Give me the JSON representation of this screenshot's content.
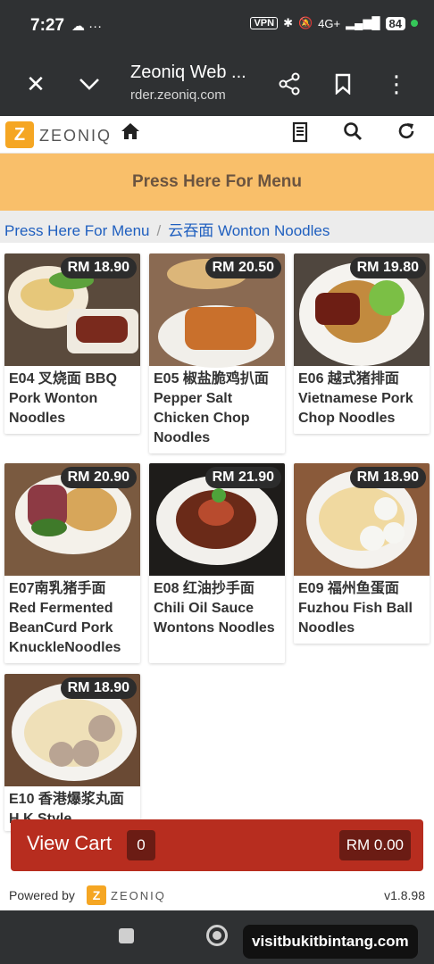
{
  "status_bar": {
    "time": "7:27",
    "left_icons": "☁ ···",
    "vpn": "VPN",
    "network": "4G+",
    "battery": "84"
  },
  "browser": {
    "title": "Zeoniq Web ...",
    "url": "rder.zeoniq.com",
    "close_icon": "close-icon",
    "chevron_icon": "chevron-down-icon",
    "share_icon": "share-icon",
    "bookmark_icon": "bookmark-icon",
    "more_icon": "more-icon"
  },
  "header": {
    "logo_letter": "Z",
    "logo_text": "ZEONIQ",
    "icons": [
      "home-icon",
      "receipt-icon",
      "search-icon",
      "refresh-icon"
    ]
  },
  "menu_banner": {
    "label": "Press Here For Menu"
  },
  "breadcrumb": {
    "root": "Press Here For Menu",
    "separator": "/",
    "current": "云吞面 Wonton Noodles"
  },
  "products": [
    {
      "code": "E04",
      "name": "E04 叉烧面 BBQ Pork Wonton Noodles",
      "price": "RM 18.90"
    },
    {
      "code": "E05",
      "name": "E05 椒盐脆鸡扒面 Pepper Salt Chicken Chop Noodles",
      "price": "RM 20.50"
    },
    {
      "code": "E06",
      "name": "E06 越式猪排面 Vietnamese Pork Chop Noodles",
      "price": "RM 19.80"
    },
    {
      "code": "E07",
      "name": "E07南乳猪手面 Red Fermented BeanCurd Pork KnuckleNoodles",
      "price": "RM 20.90"
    },
    {
      "code": "E08",
      "name": "E08 红油抄手面 Chili Oil Sauce Wontons Noodles",
      "price": "RM 21.90"
    },
    {
      "code": "E09",
      "name": "E09 福州鱼蛋面 Fuzhou Fish Ball Noodles",
      "price": "RM 18.90"
    },
    {
      "code": "E10",
      "name": "E10 香港爆浆丸面 H.K Style",
      "price": "RM 18.90"
    }
  ],
  "cart": {
    "label": "View Cart",
    "count": "0",
    "total": "RM 0.00"
  },
  "footer": {
    "powered": "Powered by",
    "logo_letter": "Z",
    "logo_text": "ZEONIQ",
    "version": "v1.8.98"
  },
  "watermark": "visitbukitbintang.com"
}
